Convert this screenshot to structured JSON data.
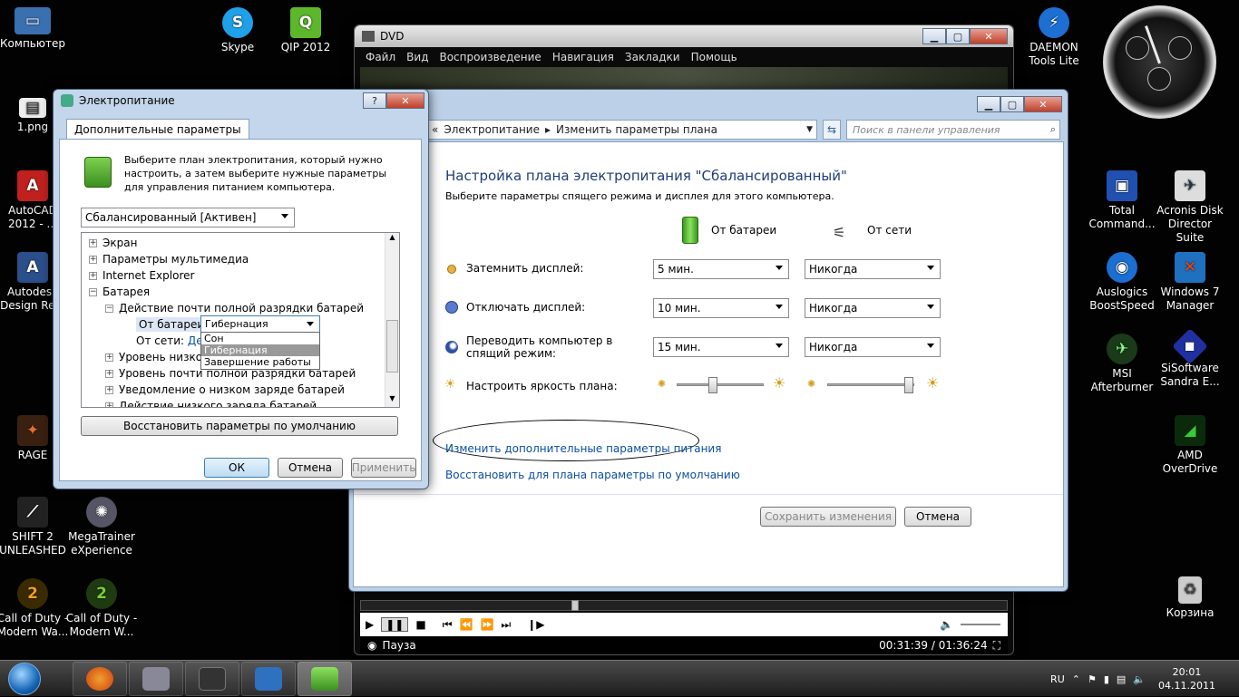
{
  "desktop_icons": [
    {
      "label": "Компьютер",
      "icon": "computer-icon"
    },
    {
      "label": "Skype",
      "icon": "skype-icon"
    },
    {
      "label": "QIP 2012",
      "icon": "qip-icon"
    },
    {
      "label": "1.png",
      "icon": "image-file-icon"
    },
    {
      "label": "AutoCAD 2012 - ...",
      "icon": "autocad-icon"
    },
    {
      "label": "Autodesk Design Re...",
      "icon": "autodesk-icon"
    },
    {
      "label": "RAGE",
      "icon": "rage-icon"
    },
    {
      "label": "SHIFT 2 UNLEASHED",
      "icon": "shift2-icon"
    },
    {
      "label": "MegaTrainer eXperience",
      "icon": "megatrainer-icon"
    },
    {
      "label": "Call of Duty - Modern Wa...",
      "icon": "cod-icon"
    },
    {
      "label": "Call of Duty - Modern W...",
      "icon": "cod-icon"
    },
    {
      "label": "DAEMON Tools Lite",
      "icon": "daemon-tools-icon"
    },
    {
      "label": "Total Command...",
      "icon": "floppy-icon"
    },
    {
      "label": "Acronis Disk Director Suite",
      "icon": "acronis-icon"
    },
    {
      "label": "Auslogics BoostSpeed",
      "icon": "auslogics-icon"
    },
    {
      "label": "Windows 7 Manager",
      "icon": "win7-manager-icon"
    },
    {
      "label": "MSI Afterburner",
      "icon": "msi-icon"
    },
    {
      "label": "SiSoftware Sandra E...",
      "icon": "sisoftware-icon"
    },
    {
      "label": "AMD OverDrive",
      "icon": "amd-icon"
    },
    {
      "label": "Корзина",
      "icon": "recycle-bin-icon"
    }
  ],
  "dvd": {
    "title": "DVD",
    "menu": [
      "Файл",
      "Вид",
      "Воспроизведение",
      "Навигация",
      "Закладки",
      "Помощь"
    ],
    "status": "Пауза",
    "time": "00:31:39 / 01:36:24",
    "progress": 0.33
  },
  "cp": {
    "breadcrumb_root": "Электропитание",
    "breadcrumb_page": "Изменить параметры плана",
    "search_placeholder": "Поиск в панели управления",
    "heading": "Настройка плана электропитания \"Сбалансированный\"",
    "subheading": "Выберите параметры спящего режима и дисплея для этого компьютера.",
    "col_battery": "От батареи",
    "col_ac": "От сети",
    "rows": [
      {
        "label": "Затемнить дисплей:",
        "battery": "5 мин.",
        "ac": "Никогда"
      },
      {
        "label": "Отключать дисплей:",
        "battery": "10 мин.",
        "ac": "Никогда"
      },
      {
        "label": "Переводить компьютер в спящий режим:",
        "battery": "15 мин.",
        "ac": "Никогда"
      }
    ],
    "brightness_label": "Настроить яркость плана:",
    "brightness_battery": 0.4,
    "brightness_ac": 1.0,
    "link_advanced": "Изменить дополнительные параметры питания",
    "link_restore": "Восстановить для плана параметры по умолчанию",
    "save": "Сохранить изменения",
    "cancel": "Отмена"
  },
  "pw": {
    "title": "Электропитание",
    "tab": "Дополнительные параметры",
    "intro": "Выберите план электропитания, который нужно настроить, а затем выберите нужные параметры для управления питанием компьютера.",
    "plan": "Сбалансированный [Активен]",
    "tree": [
      "Экран",
      "Параметры мультимедиа",
      "Internet Explorer",
      "Батарея",
      "Действие почти полной разрядки батарей",
      "От батареи:",
      "Гибернация",
      "От сети:",
      "Дей",
      "Уровень низко",
      "Уровень почти полной разрядки батарей",
      "Уведомление о низком заряде батарей",
      "Действие низкого заряда батарей"
    ],
    "dropdown": [
      "Сон",
      "Гибернация",
      "Завершение работы"
    ],
    "restore": "Восстановить параметры по умолчанию",
    "ok": "ОК",
    "cancel": "Отмена",
    "apply": "Применить"
  },
  "tray": {
    "lang": "RU",
    "time": "20:01",
    "date": "04.11.2011"
  }
}
